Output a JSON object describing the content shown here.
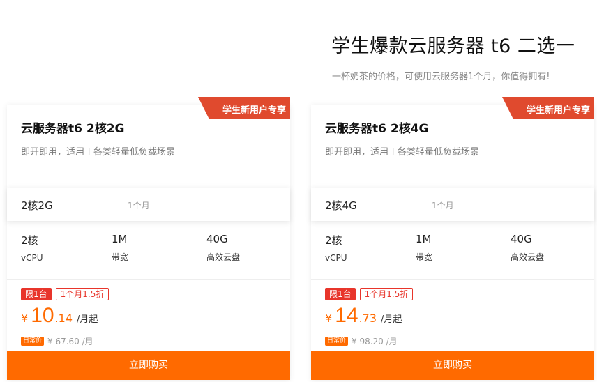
{
  "header": {
    "title": "学生爆款云服务器 t6 二选一",
    "subtitle": "一杯奶茶的价格，可使用云服务器1个月，你值得拥有!"
  },
  "colors": {
    "accent": "#ff6a00",
    "badge_red": "#e8352b"
  },
  "cards": [
    {
      "ribbon": "学生新用户专享",
      "title": "云服务器t6 2核2G",
      "desc": "即开即用，适用于各类轻量低负载场景",
      "spec": "2核2G",
      "period": "1个月",
      "stats": [
        {
          "value": "2核",
          "label": "vCPU"
        },
        {
          "value": "1M",
          "label": "带宽"
        },
        {
          "value": "40G",
          "label": "高效云盘"
        }
      ],
      "tag_limit": "限1台",
      "tag_discount": "1个月1.5折",
      "currency": "¥",
      "price_int": "10",
      "price_dec": ".14",
      "price_unit": "/月起",
      "orig_badge": "日常价",
      "orig_price": "¥ 67.60 /月",
      "buy_label": "立即购买"
    },
    {
      "ribbon": "学生新用户专享",
      "title": "云服务器t6 2核4G",
      "desc": "即开即用，适用于各类轻量低负载场景",
      "spec": "2核4G",
      "period": "1个月",
      "stats": [
        {
          "value": "2核",
          "label": "vCPU"
        },
        {
          "value": "1M",
          "label": "带宽"
        },
        {
          "value": "40G",
          "label": "高效云盘"
        }
      ],
      "tag_limit": "限1台",
      "tag_discount": "1个月1.5折",
      "currency": "¥",
      "price_int": "14",
      "price_dec": ".73",
      "price_unit": "/月起",
      "orig_badge": "日常价",
      "orig_price": "¥ 98.20 /月",
      "buy_label": "立即购买"
    }
  ]
}
